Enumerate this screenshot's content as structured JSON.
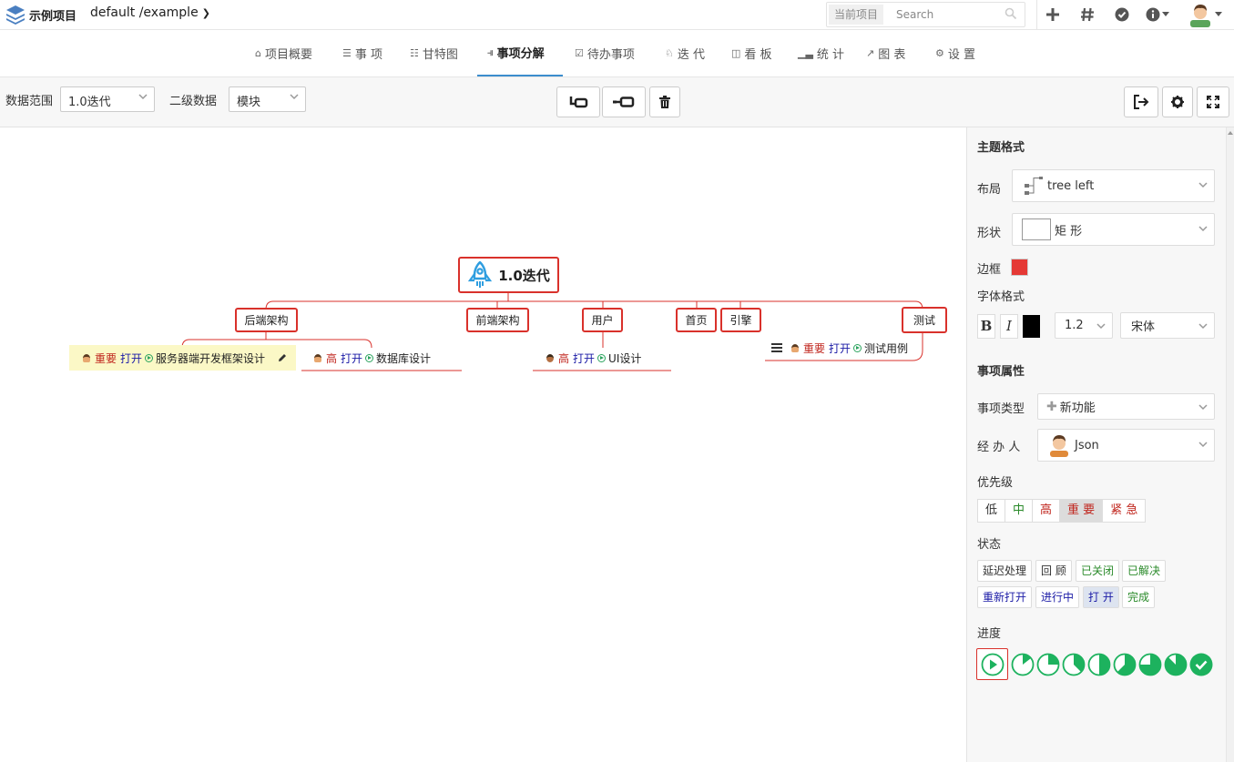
{
  "topbar": {
    "project_name": "示例项目",
    "project_path": "default /example",
    "search_scope": "当前项目",
    "search_placeholder": "Search"
  },
  "nav": {
    "tabs": [
      {
        "label": "项目概要",
        "icon": "home-icon"
      },
      {
        "label": "事 项",
        "icon": "list-icon"
      },
      {
        "label": "甘特图",
        "icon": "gantt-icon"
      },
      {
        "label": "事项分解",
        "icon": "mindmap-icon",
        "active": true
      },
      {
        "label": "待办事项",
        "icon": "checklist-icon"
      },
      {
        "label": "迭 代",
        "icon": "rocket-icon"
      },
      {
        "label": "看 板",
        "icon": "board-icon"
      },
      {
        "label": "统 计",
        "icon": "bar-chart-icon"
      },
      {
        "label": "图 表",
        "icon": "line-chart-icon"
      },
      {
        "label": "设 置",
        "icon": "gears-icon"
      }
    ]
  },
  "toolbar": {
    "range_label": "数据范围",
    "range_value": "1.0迭代",
    "secondary_label": "二级数据",
    "secondary_value": "模块"
  },
  "mindmap": {
    "root": "1.0迭代",
    "modules": [
      "后端架构",
      "前端架构",
      "用户",
      "首页",
      "引擎",
      "测试"
    ],
    "items": [
      {
        "priority": "重要",
        "status": "打开",
        "title": "服务器端开发框架设计"
      },
      {
        "priority": "高",
        "status": "打开",
        "title": "数据库设计"
      },
      {
        "priority": "高",
        "status": "打开",
        "title": "UI设计"
      },
      {
        "priority": "重要",
        "status": "打开",
        "title": "测试用例"
      }
    ]
  },
  "panel": {
    "theme_header": "主题格式",
    "layout_label": "布局",
    "layout_value": "tree left",
    "shape_label": "形状",
    "shape_value": "矩 形",
    "border_label": "边框",
    "border_color": "#e53935",
    "font_label": "字体格式",
    "font_bold": "B",
    "font_italic": "I",
    "font_color": "#000000",
    "font_size": "1.2",
    "font_family": "宋体",
    "props_header": "事项属性",
    "type_label": "事项类型",
    "type_value": "新功能",
    "assignee_label": "经 办 人",
    "assignee_value": "Json",
    "priority_label": "优先级",
    "priorities": [
      "低",
      "中",
      "高",
      "重 要",
      "紧 急"
    ],
    "status_label": "状态",
    "statuses_row1": [
      "延迟处理",
      "回 顾",
      "已关闭",
      "已解决"
    ],
    "statuses_row2": [
      "重新打开",
      "进行中",
      "打 开",
      "完成"
    ],
    "progress_label": "进度",
    "progress_fraction": 0
  }
}
